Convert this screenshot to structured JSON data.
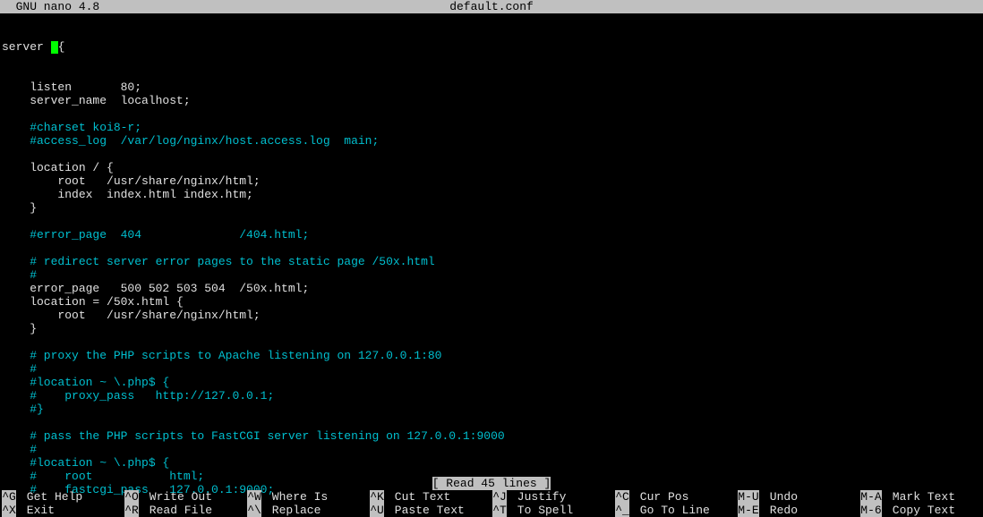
{
  "titlebar": {
    "app_name": "  GNU nano 4.8",
    "filename": "default.conf"
  },
  "editor": {
    "first_line_prefix": "server ",
    "first_line_suffix": "{",
    "lines": [
      {
        "cls": "plain",
        "text": "    listen       80;"
      },
      {
        "cls": "plain",
        "text": "    server_name  localhost;"
      },
      {
        "cls": "plain",
        "text": ""
      },
      {
        "cls": "comment",
        "text": "    #charset koi8-r;"
      },
      {
        "cls": "comment",
        "text": "    #access_log  /var/log/nginx/host.access.log  main;"
      },
      {
        "cls": "plain",
        "text": ""
      },
      {
        "cls": "plain",
        "text": "    location / {"
      },
      {
        "cls": "plain",
        "text": "        root   /usr/share/nginx/html;"
      },
      {
        "cls": "plain",
        "text": "        index  index.html index.htm;"
      },
      {
        "cls": "plain",
        "text": "    }"
      },
      {
        "cls": "plain",
        "text": ""
      },
      {
        "cls": "comment",
        "text": "    #error_page  404              /404.html;"
      },
      {
        "cls": "plain",
        "text": ""
      },
      {
        "cls": "comment",
        "text": "    # redirect server error pages to the static page /50x.html"
      },
      {
        "cls": "comment",
        "text": "    #"
      },
      {
        "cls": "plain",
        "text": "    error_page   500 502 503 504  /50x.html;"
      },
      {
        "cls": "plain",
        "text": "    location = /50x.html {"
      },
      {
        "cls": "plain",
        "text": "        root   /usr/share/nginx/html;"
      },
      {
        "cls": "plain",
        "text": "    }"
      },
      {
        "cls": "plain",
        "text": ""
      },
      {
        "cls": "comment",
        "text": "    # proxy the PHP scripts to Apache listening on 127.0.0.1:80"
      },
      {
        "cls": "comment",
        "text": "    #"
      },
      {
        "cls": "comment",
        "text": "    #location ~ \\.php$ {"
      },
      {
        "cls": "comment",
        "text": "    #    proxy_pass   http://127.0.0.1;"
      },
      {
        "cls": "comment",
        "text": "    #}"
      },
      {
        "cls": "plain",
        "text": ""
      },
      {
        "cls": "comment",
        "text": "    # pass the PHP scripts to FastCGI server listening on 127.0.0.1:9000"
      },
      {
        "cls": "comment",
        "text": "    #"
      },
      {
        "cls": "comment",
        "text": "    #location ~ \\.php$ {"
      },
      {
        "cls": "comment",
        "text": "    #    root           html;"
      },
      {
        "cls": "comment",
        "text": "    #    fastcgi_pass   127.0.0.1:9000;"
      }
    ]
  },
  "status": {
    "text": "[ Read 45 lines ]"
  },
  "shortcuts": {
    "row1": [
      {
        "key": "^G",
        "label": "Get Help"
      },
      {
        "key": "^O",
        "label": "Write Out"
      },
      {
        "key": "^W",
        "label": "Where Is"
      },
      {
        "key": "^K",
        "label": "Cut Text"
      },
      {
        "key": "^J",
        "label": "Justify"
      },
      {
        "key": "^C",
        "label": "Cur Pos"
      },
      {
        "key": "M-U",
        "label": "Undo"
      },
      {
        "key": "M-A",
        "label": "Mark Text"
      }
    ],
    "row2": [
      {
        "key": "^X",
        "label": "Exit"
      },
      {
        "key": "^R",
        "label": "Read File"
      },
      {
        "key": "^\\",
        "label": "Replace"
      },
      {
        "key": "^U",
        "label": "Paste Text"
      },
      {
        "key": "^T",
        "label": "To Spell"
      },
      {
        "key": "^_",
        "label": "Go To Line"
      },
      {
        "key": "M-E",
        "label": "Redo"
      },
      {
        "key": "M-6",
        "label": "Copy Text"
      }
    ]
  }
}
